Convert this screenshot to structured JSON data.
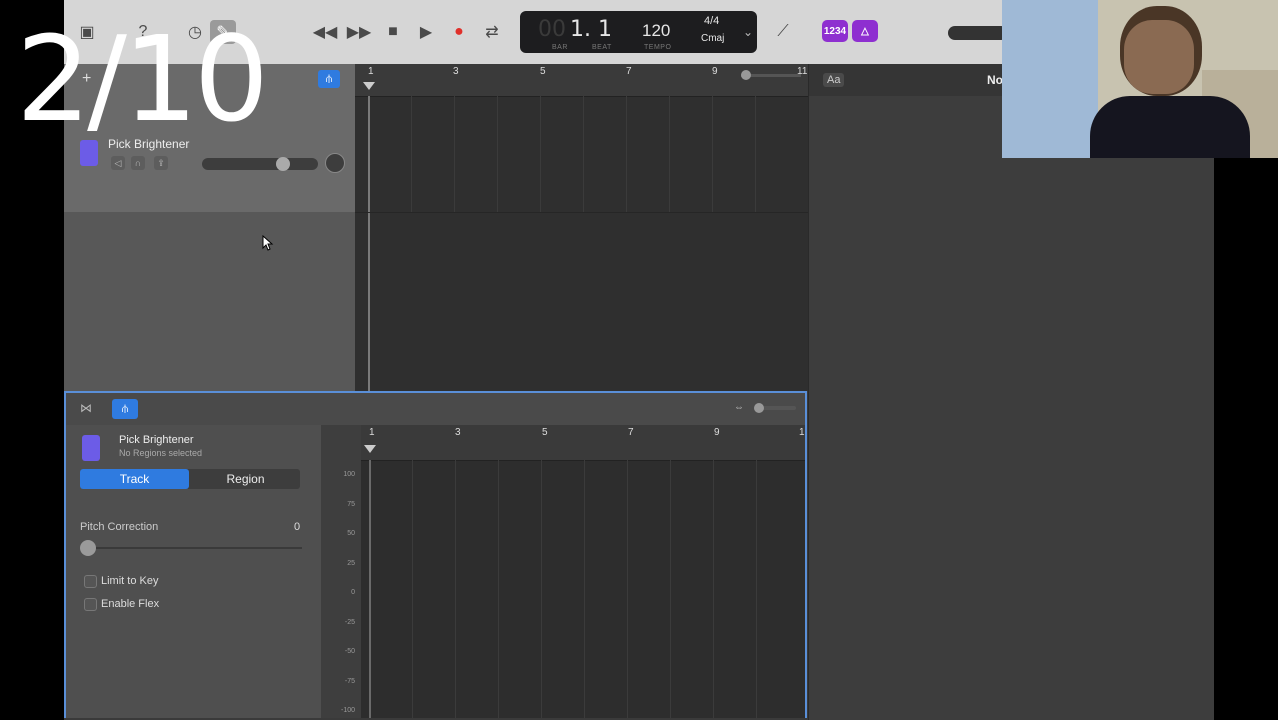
{
  "overlay": {
    "counter": "2/10"
  },
  "transport": {
    "lcd": {
      "bar": "00",
      "beat_value": "1. 1",
      "bar_label": "BAR",
      "beat_label": "BEAT",
      "tempo": "120",
      "tempo_label": "TEMPO",
      "time_signature": "4/4",
      "key": "Cmaj"
    },
    "badges": {
      "count_in": "1234"
    }
  },
  "track": {
    "name": "Pick Brightener"
  },
  "ruler": {
    "bars": [
      "1",
      "3",
      "5",
      "7",
      "9",
      "11"
    ]
  },
  "right_panel": {
    "aa_label": "Aa",
    "note_label": "No"
  },
  "editor": {
    "track_name": "Pick Brightener",
    "subtitle": "No Regions selected",
    "tabs": [
      "Track",
      "Region"
    ],
    "active_tab": "Track",
    "pitch_correction": {
      "label": "Pitch Correction",
      "value": "0"
    },
    "options": [
      {
        "label": "Limit to Key",
        "checked": false
      },
      {
        "label": "Enable Flex",
        "checked": false
      }
    ],
    "ruler": [
      "1",
      "3",
      "5",
      "7",
      "9",
      "1"
    ],
    "axis": [
      "100",
      "75",
      "50",
      "25",
      "0",
      "-25",
      "-50",
      "-75",
      "-100"
    ]
  },
  "colors": {
    "accent": "#2f7be0",
    "record": "#e0302a",
    "badge": "#8e2fd0",
    "selection_border": "#5a8fd8"
  }
}
